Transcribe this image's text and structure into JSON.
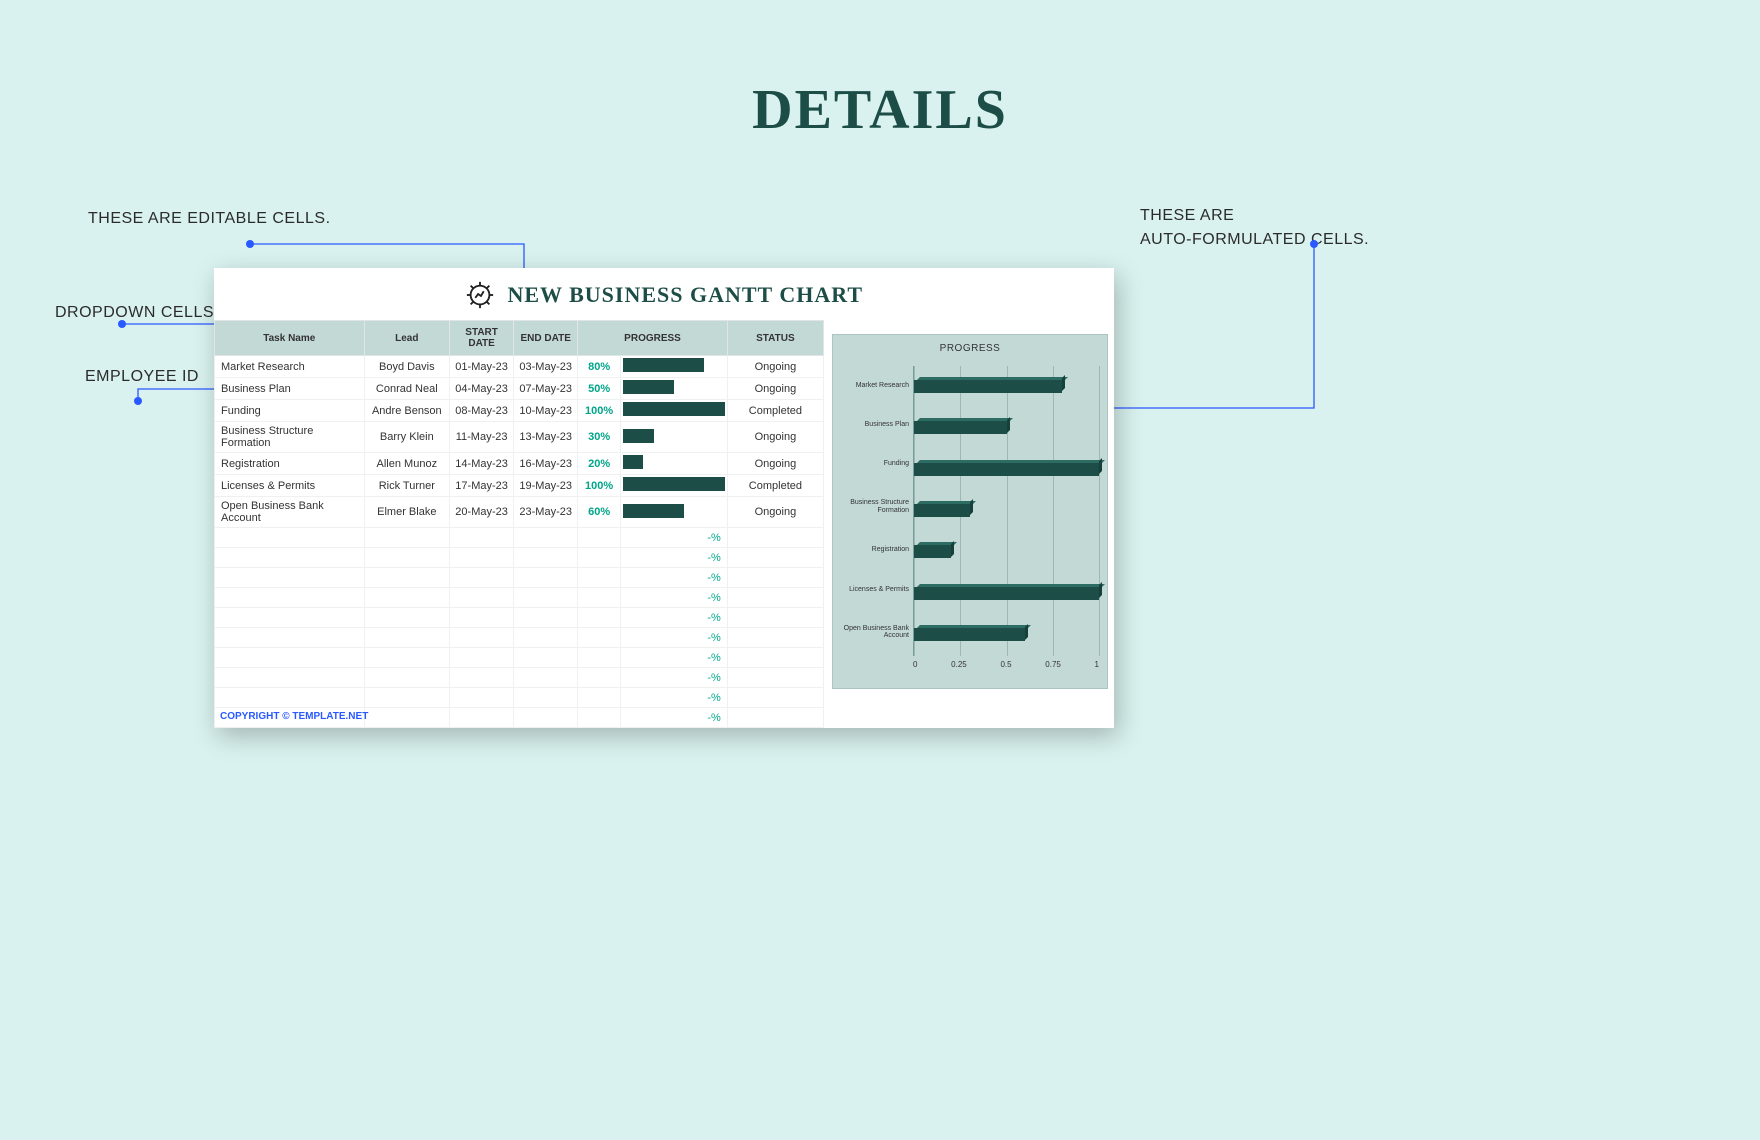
{
  "page_title": "DETAILS",
  "annotations": {
    "editable": "THESE ARE EDITABLE CELLS.",
    "dropdown": "DROPDOWN CELLS",
    "employee": "EMPLOYEE ID",
    "auto_line1": "THESE ARE",
    "auto_line2": "AUTO-FORMULATED CELLS."
  },
  "panel": {
    "title": "NEW BUSINESS GANTT CHART",
    "columns": [
      "Task Name",
      "Lead",
      "START DATE",
      "END DATE",
      "PROGRESS",
      "",
      "STATUS"
    ],
    "rows": [
      {
        "task": "Market Research",
        "lead": "Boyd Davis",
        "start": "01-May-23",
        "end": "03-May-23",
        "pct": "80%",
        "pct_val": 80,
        "status": "Ongoing"
      },
      {
        "task": "Business Plan",
        "lead": "Conrad Neal",
        "start": "04-May-23",
        "end": "07-May-23",
        "pct": "50%",
        "pct_val": 50,
        "status": "Ongoing"
      },
      {
        "task": "Funding",
        "lead": "Andre Benson",
        "start": "08-May-23",
        "end": "10-May-23",
        "pct": "100%",
        "pct_val": 100,
        "status": "Completed"
      },
      {
        "task": "Business Structure Formation",
        "lead": "Barry Klein",
        "start": "11-May-23",
        "end": "13-May-23",
        "pct": "30%",
        "pct_val": 30,
        "status": "Ongoing"
      },
      {
        "task": "Registration",
        "lead": "Allen Munoz",
        "start": "14-May-23",
        "end": "16-May-23",
        "pct": "20%",
        "pct_val": 20,
        "status": "Ongoing"
      },
      {
        "task": "Licenses & Permits",
        "lead": "Rick Turner",
        "start": "17-May-23",
        "end": "19-May-23",
        "pct": "100%",
        "pct_val": 100,
        "status": "Completed"
      },
      {
        "task": "Open Business Bank Account",
        "lead": "Elmer Blake",
        "start": "20-May-23",
        "end": "23-May-23",
        "pct": "60%",
        "pct_val": 60,
        "status": "Ongoing"
      }
    ],
    "empty_placeholder": "-%",
    "empty_rows": 10,
    "footer": "COPYRIGHT © TEMPLATE.NET"
  },
  "chart_data": {
    "type": "bar",
    "title": "PROGRESS",
    "orientation": "horizontal",
    "categories": [
      "Market Research",
      "Business Plan",
      "Funding",
      "Business Structure Formation",
      "Registration",
      "Licenses & Permits",
      "Open Business Bank Account"
    ],
    "values": [
      0.8,
      0.5,
      1.0,
      0.3,
      0.2,
      1.0,
      0.6
    ],
    "xlim": [
      0,
      1
    ],
    "xticks": [
      "0",
      "0.25",
      "0.5",
      "0.75",
      "1"
    ]
  }
}
